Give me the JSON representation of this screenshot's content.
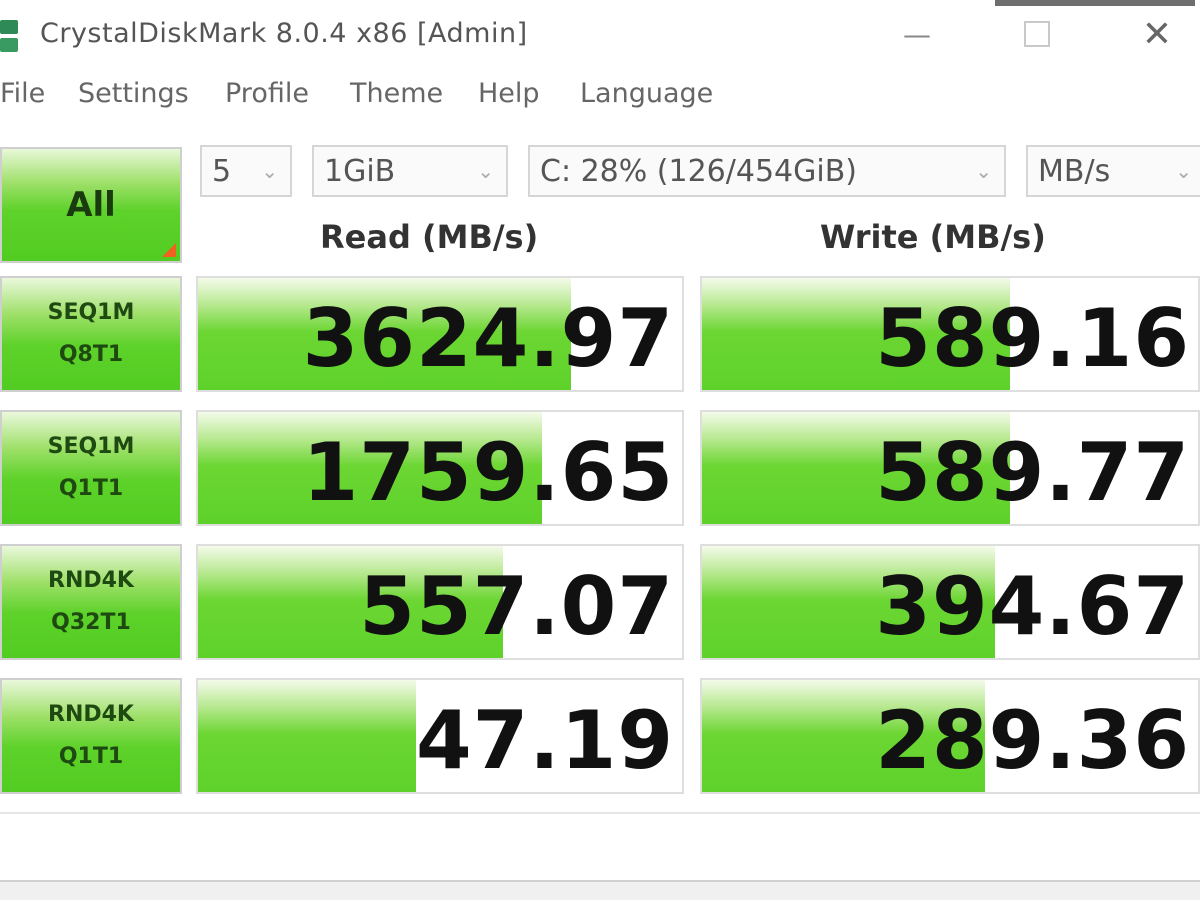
{
  "window": {
    "title": "CrystalDiskMark 8.0.4 x86 [Admin]",
    "minimize_glyph": "—",
    "close_glyph": "✕"
  },
  "menu": {
    "items": [
      "File",
      "Settings",
      "Profile",
      "Theme",
      "Help",
      "Language"
    ]
  },
  "toolbar": {
    "all_label": "All",
    "count": "5",
    "size": "1GiB",
    "drive": "C: 28% (126/454GiB)",
    "unit": "MB/s",
    "arrow_glyph": "⌄"
  },
  "headers": {
    "read": "Read (MB/s)",
    "write": "Write (MB/s)"
  },
  "rows": [
    {
      "line1": "SEQ1M",
      "line2": "Q8T1",
      "read": "3624.97",
      "write": "589.16",
      "read_fill": 0.77,
      "write_fill": 0.62
    },
    {
      "line1": "SEQ1M",
      "line2": "Q1T1",
      "read": "1759.65",
      "write": "589.77",
      "read_fill": 0.71,
      "write_fill": 0.62
    },
    {
      "line1": "RND4K",
      "line2": "Q32T1",
      "read": "557.07",
      "write": "394.67",
      "read_fill": 0.63,
      "write_fill": 0.59
    },
    {
      "line1": "RND4K",
      "line2": "Q1T1",
      "read": "47.19",
      "write": "289.36",
      "read_fill": 0.45,
      "write_fill": 0.57
    }
  ],
  "colors": {
    "bar_green": "#5ed22a",
    "corner_orange": "#f06020"
  }
}
